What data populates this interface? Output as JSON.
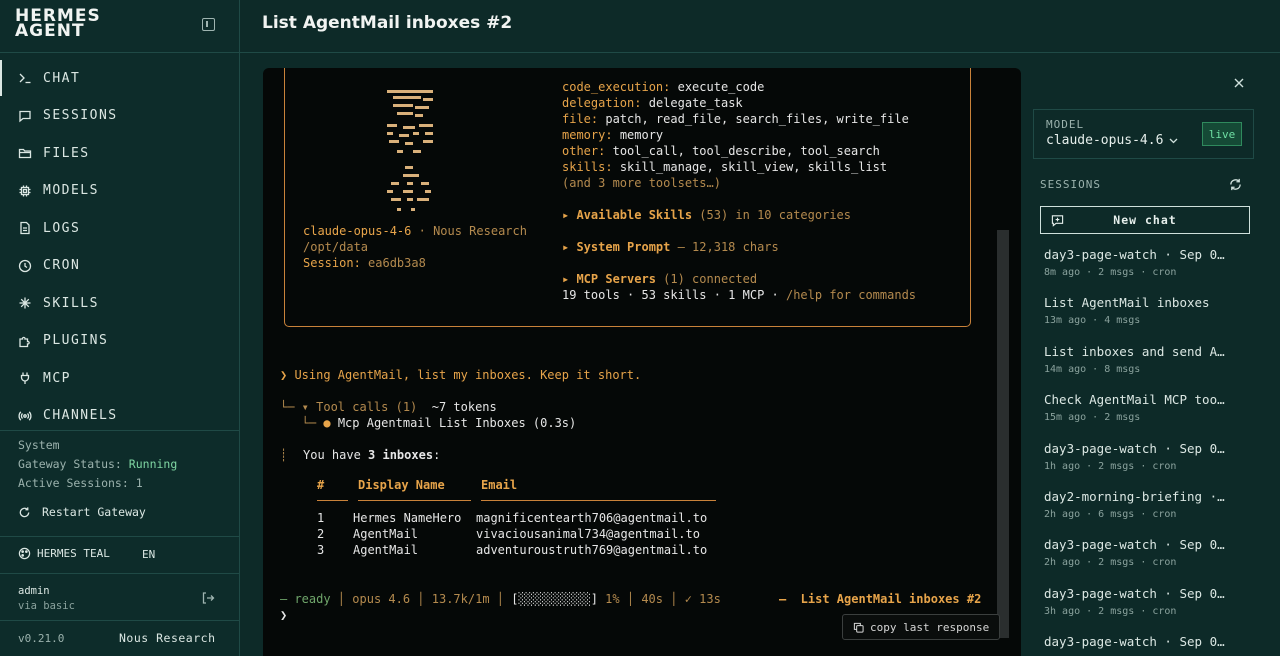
{
  "brand": {
    "line1": "HERMES",
    "line2": "AGENT"
  },
  "nav": [
    {
      "label": "CHAT",
      "icon": "terminal-icon",
      "active": true
    },
    {
      "label": "SESSIONS",
      "icon": "message-square-icon"
    },
    {
      "label": "FILES",
      "icon": "folder-icon"
    },
    {
      "label": "MODELS",
      "icon": "cpu-icon"
    },
    {
      "label": "LOGS",
      "icon": "file-text-icon"
    },
    {
      "label": "CRON",
      "icon": "clock-icon"
    },
    {
      "label": "SKILLS",
      "icon": "sparkle-icon"
    },
    {
      "label": "PLUGINS",
      "icon": "puzzle-icon"
    },
    {
      "label": "MCP",
      "icon": "plug-icon"
    },
    {
      "label": "CHANNELS",
      "icon": "radio-icon"
    }
  ],
  "system": {
    "title": "System",
    "gateway_label": "Gateway Status:",
    "gateway_value": "Running",
    "sessions_label": "Active Sessions:",
    "sessions_value": "1",
    "restart_label": "Restart Gateway"
  },
  "theme": {
    "label": "HERMES TEAL",
    "lang": "EN"
  },
  "user": {
    "name": "admin",
    "auth": "via basic"
  },
  "footer": {
    "version": "v0.21.0",
    "org": "Nous Research"
  },
  "page": {
    "title": "List AgentMail inboxes #2"
  },
  "terminal": {
    "model_line": "claude-opus-4-6",
    "model_sep": " · ",
    "model_vendor": "Nous Research",
    "path": "/opt/data",
    "session_label": "Session:",
    "session_id": "ea6db3a8",
    "toolsets": [
      {
        "key": "code_execution:",
        "value": "execute_code"
      },
      {
        "key": "delegation:",
        "value": "delegate_task"
      },
      {
        "key": "file:",
        "value": "patch, read_file, search_files, write_file"
      },
      {
        "key": "memory:",
        "value": "memory"
      },
      {
        "key": "other:",
        "value": "tool_call, tool_describe, tool_search"
      },
      {
        "key": "skills:",
        "value": "skill_manage, skill_view, skills_list"
      }
    ],
    "more_toolsets": "(and 3 more toolsets…)",
    "skills_heading": "▸ Available Skills",
    "skills_detail": " (53) in 10 categories",
    "prompt_heading": "▸ System Prompt",
    "prompt_detail": " — 12,318 chars",
    "mcp_heading": "▸ MCP Servers",
    "mcp_detail": " (1) connected",
    "summary": "19 tools · 53 skills · 1 MCP · ",
    "summary_help": "/help for commands",
    "user_prompt": "❯ Using AgentMail, list my inboxes. Keep it short.",
    "tool_calls_prefix": "└─ ▾ ",
    "tool_calls_label": "Tool calls (1)",
    "tool_calls_tokens": "  ~7 tokens",
    "tool_item_prefix": "   └─ ",
    "tool_item_label": "Mcp Agentmail List Inboxes",
    "tool_item_time": " (0.3s)",
    "reply_bar": "┊",
    "reply_pre": "You have ",
    "reply_bold": "3 inboxes",
    "reply_post": ":",
    "table_headers": [
      "#",
      "Display Name",
      "Email"
    ],
    "table_rows": [
      [
        "1",
        "Hermes NameHero",
        "magnificentearth706@agentmail.to"
      ],
      [
        "2",
        "AgentMail",
        "vivaciousanimal734@agentmail.to"
      ],
      [
        "3",
        "AgentMail",
        "adventuroustruth769@agentmail.to"
      ]
    ],
    "status": {
      "ready": "— ready",
      "model": "opus 4.6",
      "tokens": "13.7k/1m",
      "progress_bar": "[░░░░░░░░░░]",
      "progress_pct": "1%",
      "progress_value": 0.01,
      "elapsed": "40s",
      "check": "✓ 13s",
      "session": "—  List AgentMail inboxes #2"
    },
    "cursor": "❯",
    "copy_label": "copy last response"
  },
  "right_panel": {
    "model_label": "MODEL",
    "model_value": "claude-opus-4.6",
    "live_label": "live",
    "sessions_label": "SESSIONS",
    "new_chat": "New chat",
    "sessions": [
      {
        "title": "day3-page-watch · Sep 0…",
        "meta": "8m ago · 2 msgs · cron"
      },
      {
        "title": "List AgentMail inboxes",
        "meta": "13m ago · 4 msgs"
      },
      {
        "title": "List inboxes and send A…",
        "meta": "14m ago · 8 msgs"
      },
      {
        "title": "Check AgentMail MCP too…",
        "meta": "15m ago · 2 msgs"
      },
      {
        "title": "day3-page-watch · Sep 0…",
        "meta": "1h ago · 2 msgs · cron"
      },
      {
        "title": "day2-morning-briefing ·…",
        "meta": "2h ago · 6 msgs · cron"
      },
      {
        "title": "day3-page-watch · Sep 0…",
        "meta": "2h ago · 2 msgs · cron"
      },
      {
        "title": "day3-page-watch · Sep 0…",
        "meta": "3h ago · 2 msgs · cron"
      },
      {
        "title": "day3-page-watch · Sep 0…",
        "meta": ""
      }
    ]
  },
  "colors": {
    "background": "#0d2a28",
    "accent": "#e7a44a",
    "running": "#7fd6a3",
    "live": "#6fe0a4"
  }
}
